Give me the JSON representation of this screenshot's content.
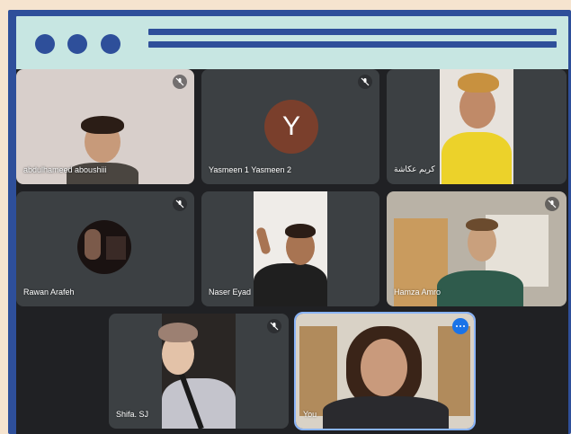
{
  "window": {
    "titlebar_dots": 3,
    "colors": {
      "frame": "#2e4f9a",
      "titlebar": "#c7e6e2",
      "background": "#f6e4cf",
      "grid": "#202124",
      "tile": "#3c4043"
    }
  },
  "participants": [
    {
      "name": "abdulhameed aboushiii",
      "muted": true
    },
    {
      "name": "Yasmeen 1 Yasmeen 2",
      "muted": true,
      "avatar_letter": "Y"
    },
    {
      "name": "كريم عكاشة",
      "muted": false
    },
    {
      "name": "Rawan Arafeh",
      "muted": true
    },
    {
      "name": "Naser Eyad",
      "muted": false
    },
    {
      "name": "Hamza Amro",
      "muted": true
    },
    {
      "name": "Shifa. SJ",
      "muted": true
    },
    {
      "name": "You",
      "muted": false,
      "more_options_icon": "more-horiz-icon"
    }
  ]
}
